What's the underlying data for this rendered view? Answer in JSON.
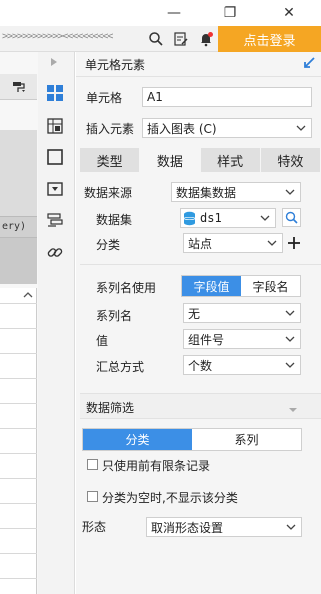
{
  "titlebar": {
    "minimize": "—",
    "maximize": "❐",
    "close": "✕"
  },
  "toolbar": {
    "chevrons": ">>>>>>>>>>>><<<<<<<<<<",
    "login_label": "点击登录"
  },
  "left": {
    "fragment_text": "ery)"
  },
  "panel": {
    "header_title": "单元格元素",
    "cell_label": "单元格",
    "cell_value": "A1",
    "insert_label": "插入元素",
    "insert_value": "插入图表 (C)",
    "tabs": [
      {
        "label": "类型"
      },
      {
        "label": "数据"
      },
      {
        "label": "样式"
      },
      {
        "label": "特效"
      }
    ],
    "data_source_label": "数据来源",
    "data_source_value": "数据集数据",
    "dataset_label": "数据集",
    "dataset_value": "ds1",
    "category_label": "分类",
    "category_value": "站点",
    "series_name_use_label": "系列名使用",
    "series_toggle": [
      "字段值",
      "字段名"
    ],
    "series_name_label": "系列名",
    "series_name_value": "无",
    "value_label": "值",
    "value_value": "组件号",
    "summary_label": "汇总方式",
    "summary_value": "个数",
    "filter_title": "数据筛选",
    "filter_tabs": [
      "分类",
      "系列"
    ],
    "check1": "只使用前有限条记录",
    "check2": "分类为空时,不显示该分类",
    "shape_label": "形态",
    "shape_value": "取消形态设置"
  },
  "colors": {
    "accent": "#3c8fe6",
    "login": "#f5a623"
  }
}
